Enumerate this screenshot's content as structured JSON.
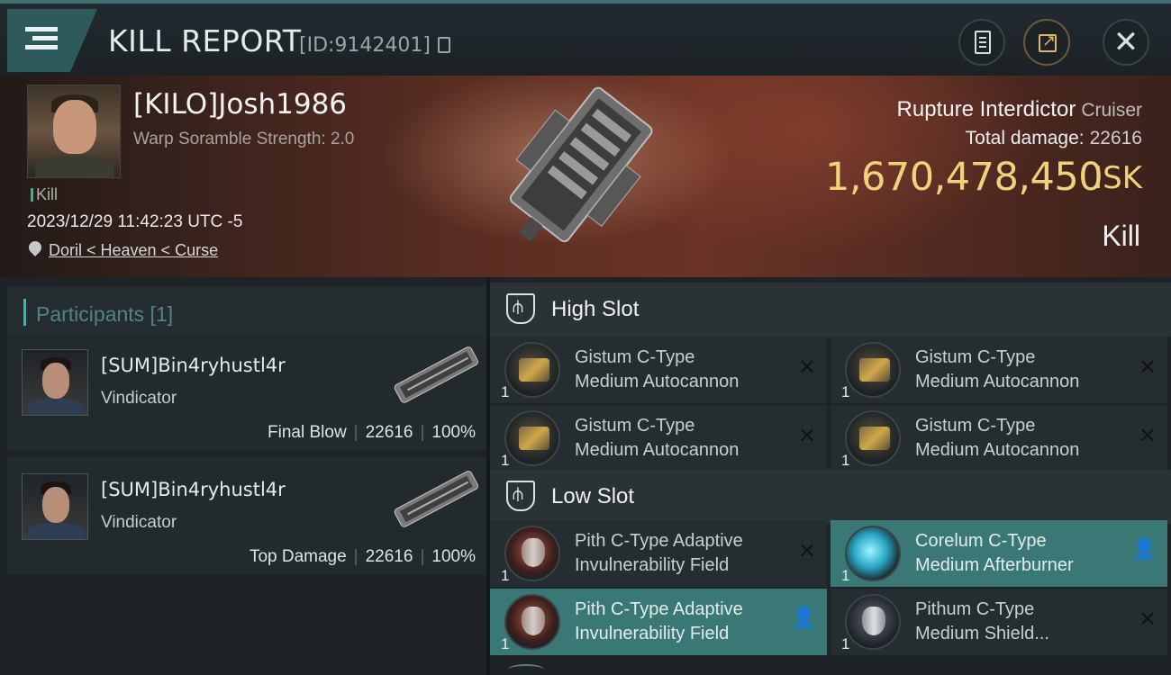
{
  "header": {
    "title": "KILL REPORT",
    "kill_id": "[ID:9142401]"
  },
  "victim": {
    "name": "[KILO]Josh1986",
    "warp_scramble": "Warp Soramble Strength: 2.0",
    "kill_tag": "Kill",
    "datetime": "2023/12/29 11:42:23 UTC -5",
    "location": "Doril < Heaven < Curse"
  },
  "ship": {
    "name": "Rupture Interdictor",
    "class": "Cruiser",
    "total_damage_label": "Total damage:",
    "total_damage": "22616",
    "isk_value": "1,670,478,450",
    "isk_unit": "ISK",
    "outcome": "Kill"
  },
  "participants": {
    "title": "Participants [1]",
    "rows": [
      {
        "name": "[SUM]Bin4ryhustl4r",
        "ship": "Vindicator",
        "role": "Final Blow",
        "damage": "22616",
        "percent": "100%"
      },
      {
        "name": "[SUM]Bin4ryhustl4r",
        "ship": "Vindicator",
        "role": "Top Damage",
        "damage": "22616",
        "percent": "100%"
      }
    ]
  },
  "slots": {
    "high": {
      "title": "High Slot",
      "modules": [
        {
          "line1": "Gistum C-Type",
          "line2": "Medium Autocannon",
          "qty": "1",
          "status": "✕"
        },
        {
          "line1": "Gistum C-Type",
          "line2": "Medium Autocannon",
          "qty": "1",
          "status": "✕"
        },
        {
          "line1": "Gistum C-Type",
          "line2": "Medium Autocannon",
          "qty": "1",
          "status": "✕"
        },
        {
          "line1": "Gistum C-Type",
          "line2": "Medium Autocannon",
          "qty": "1",
          "status": "✕"
        }
      ]
    },
    "low": {
      "title": "Low Slot",
      "modules": [
        {
          "line1": "Pith C-Type Adaptive",
          "line2": "Invulnerability Field",
          "qty": "1",
          "status": "✕"
        },
        {
          "line1": "Corelum C-Type",
          "line2": "Medium Afterburner",
          "qty": "1",
          "status": "👤"
        },
        {
          "line1": "Pith C-Type Adaptive",
          "line2": "Invulnerability Field",
          "qty": "1",
          "status": "👤"
        },
        {
          "line1": "Pithum C-Type",
          "line2": "Medium Shield...",
          "qty": "1",
          "status": "✕"
        }
      ]
    }
  },
  "icons": {
    "menu": "hamburger-menu-icon",
    "copy": "copy-icon",
    "report": "clipboard-icon",
    "share": "share-external-icon",
    "close": "close-icon",
    "location": "map-pin-icon"
  },
  "colors": {
    "accent_teal": "#3a7875",
    "isk_gold": "#f0d27a",
    "participants_title": "#4f8685"
  }
}
